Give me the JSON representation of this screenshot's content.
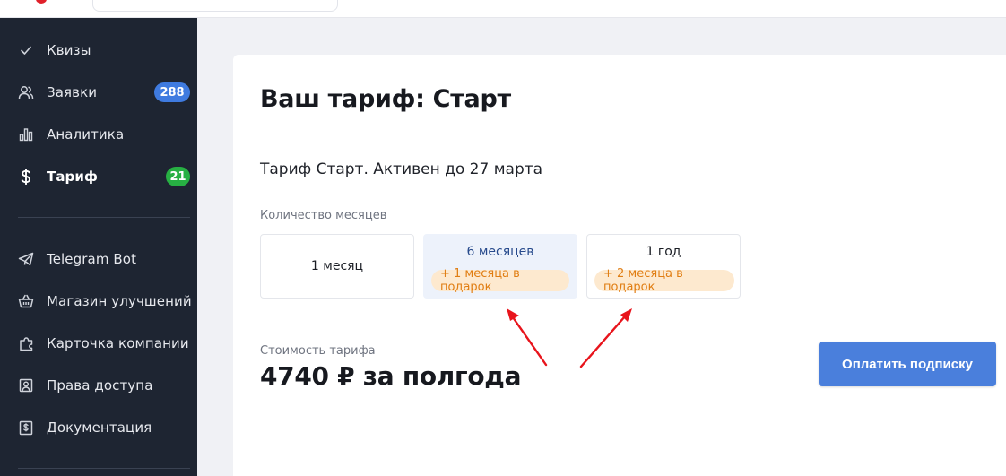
{
  "sidebar": {
    "items": [
      {
        "label": "Квизы",
        "icon": "check-icon"
      },
      {
        "label": "Заявки",
        "icon": "users-icon",
        "badge": "288",
        "badge_color": "#3f7be0"
      },
      {
        "label": "Аналитика",
        "icon": "bar-chart-icon"
      },
      {
        "label": "Тариф",
        "icon": "dollar-icon",
        "badge": "21",
        "badge_color": "#27b043",
        "active": true
      },
      {
        "label": "Telegram Bot",
        "icon": "paper-plane-icon"
      },
      {
        "label": "Магазин улучшений",
        "icon": "basket-icon"
      },
      {
        "label": "Карточка компании",
        "icon": "puzzle-icon"
      },
      {
        "label": "Права доступа",
        "icon": "user-badge-icon"
      },
      {
        "label": "Документация",
        "icon": "document-dollar-icon"
      }
    ]
  },
  "main": {
    "title": "Ваш тариф: Старт",
    "status": "Тариф Старт. Активен до 27 марта",
    "months_label": "Количество месяцев",
    "plans": [
      {
        "name": "1 месяц",
        "gift": "",
        "selected": false
      },
      {
        "name": "6 месяцев",
        "gift": "+ 1 месяца в подарок",
        "selected": true
      },
      {
        "name": "1 год",
        "gift": "+ 2 месяца в подарок",
        "selected": false
      }
    ],
    "cost_label": "Стоимость тарифа",
    "cost_value": "4740 ₽ за полгода",
    "pay_button": "Оплатить подписку"
  },
  "colors": {
    "sidebar_bg": "#1e2532",
    "accent_blue": "#4a7fdc",
    "gift_bg": "#fde9cf",
    "gift_text": "#e07d12",
    "annotation_arrow": "#e8141c"
  }
}
